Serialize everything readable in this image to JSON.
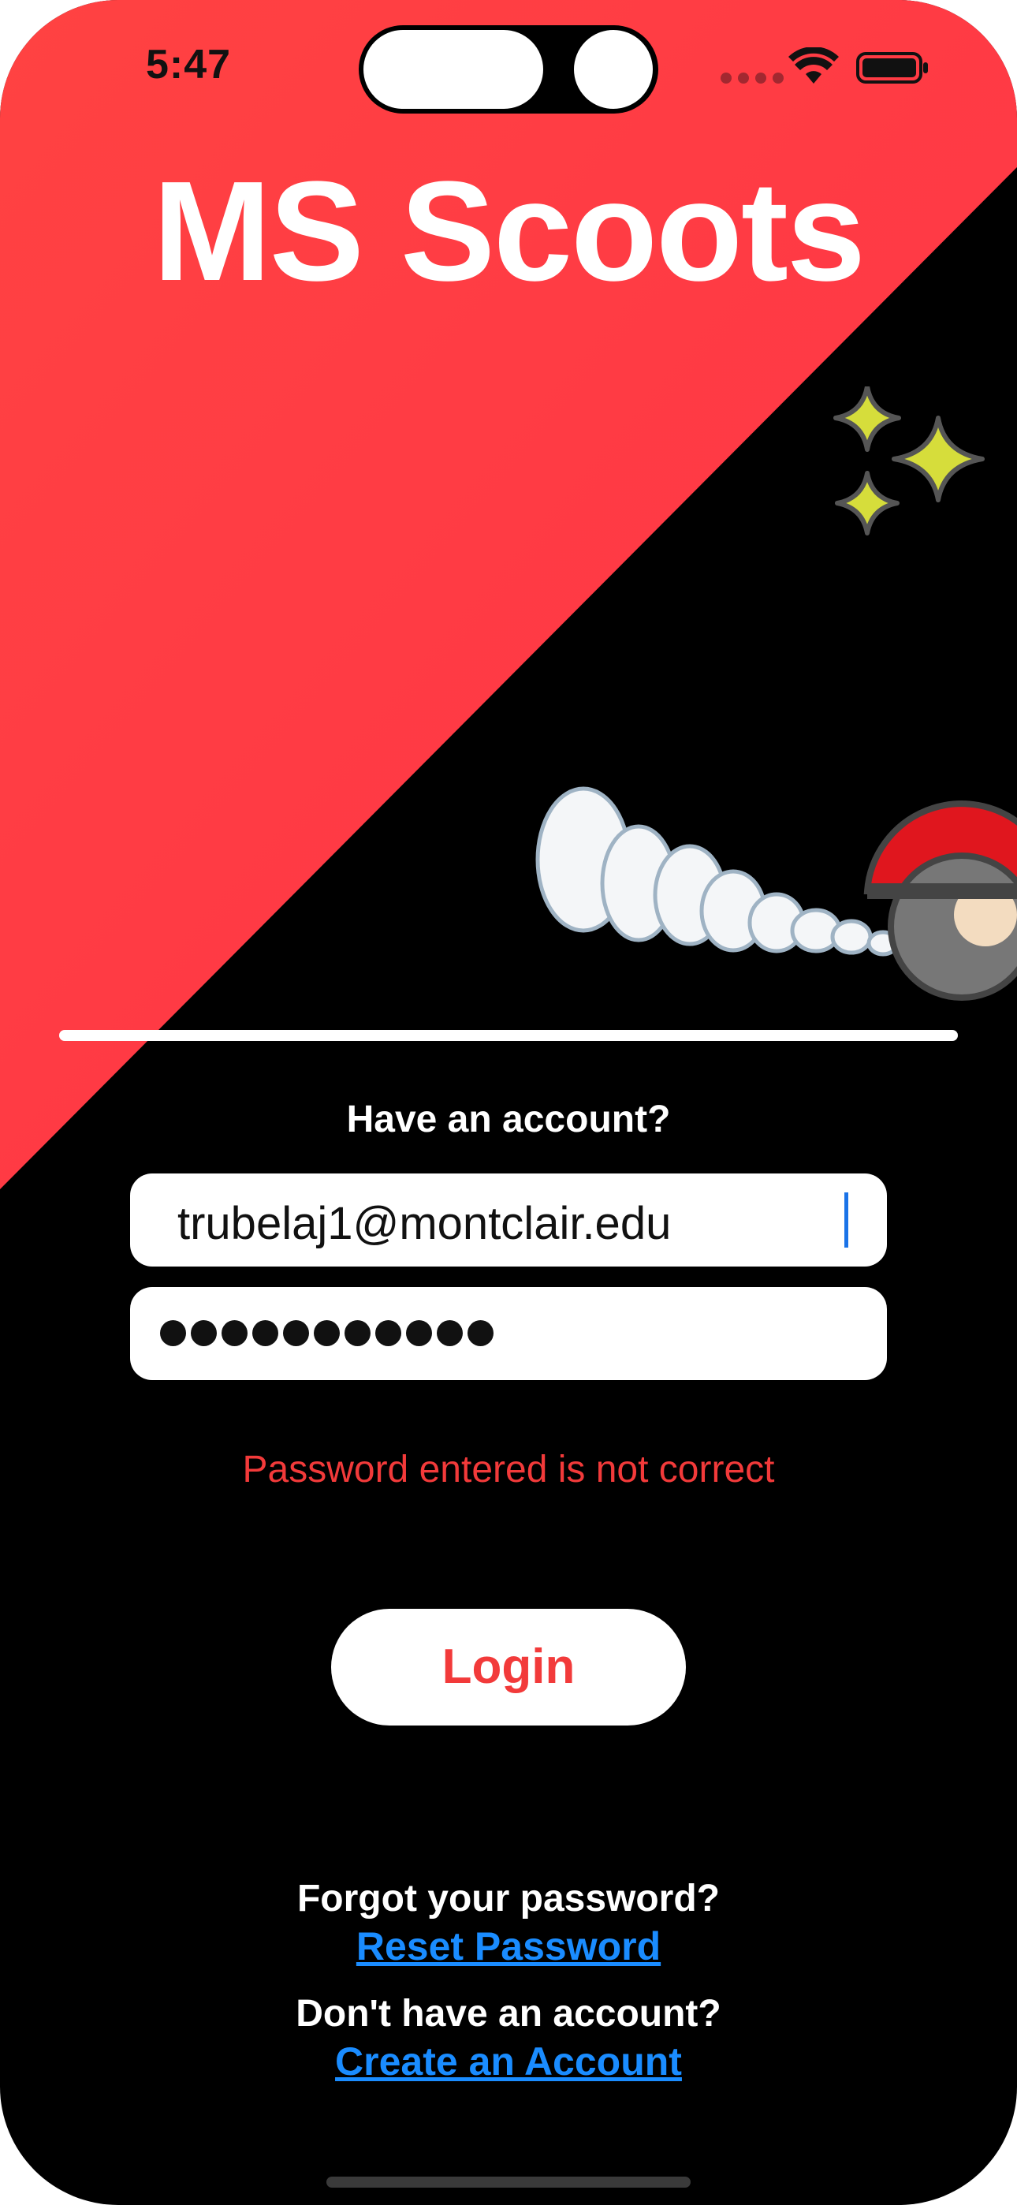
{
  "status_bar": {
    "time": "5:47"
  },
  "app": {
    "title": "MS Scoots"
  },
  "login": {
    "prompt": "Have an account?",
    "email_value": "trubelaj1@montclair.edu",
    "password_dot_count": 11,
    "error_message": "Password entered is not correct",
    "login_label": "Login"
  },
  "links": {
    "forgot_question": "Forgot your password?",
    "reset_label": "Reset Password",
    "no_account_question": "Don't have an account?",
    "create_label": "Create an Account"
  },
  "colors": {
    "brand_red": "#f23a3a",
    "link_blue": "#1a8cff",
    "background": "#000000"
  }
}
